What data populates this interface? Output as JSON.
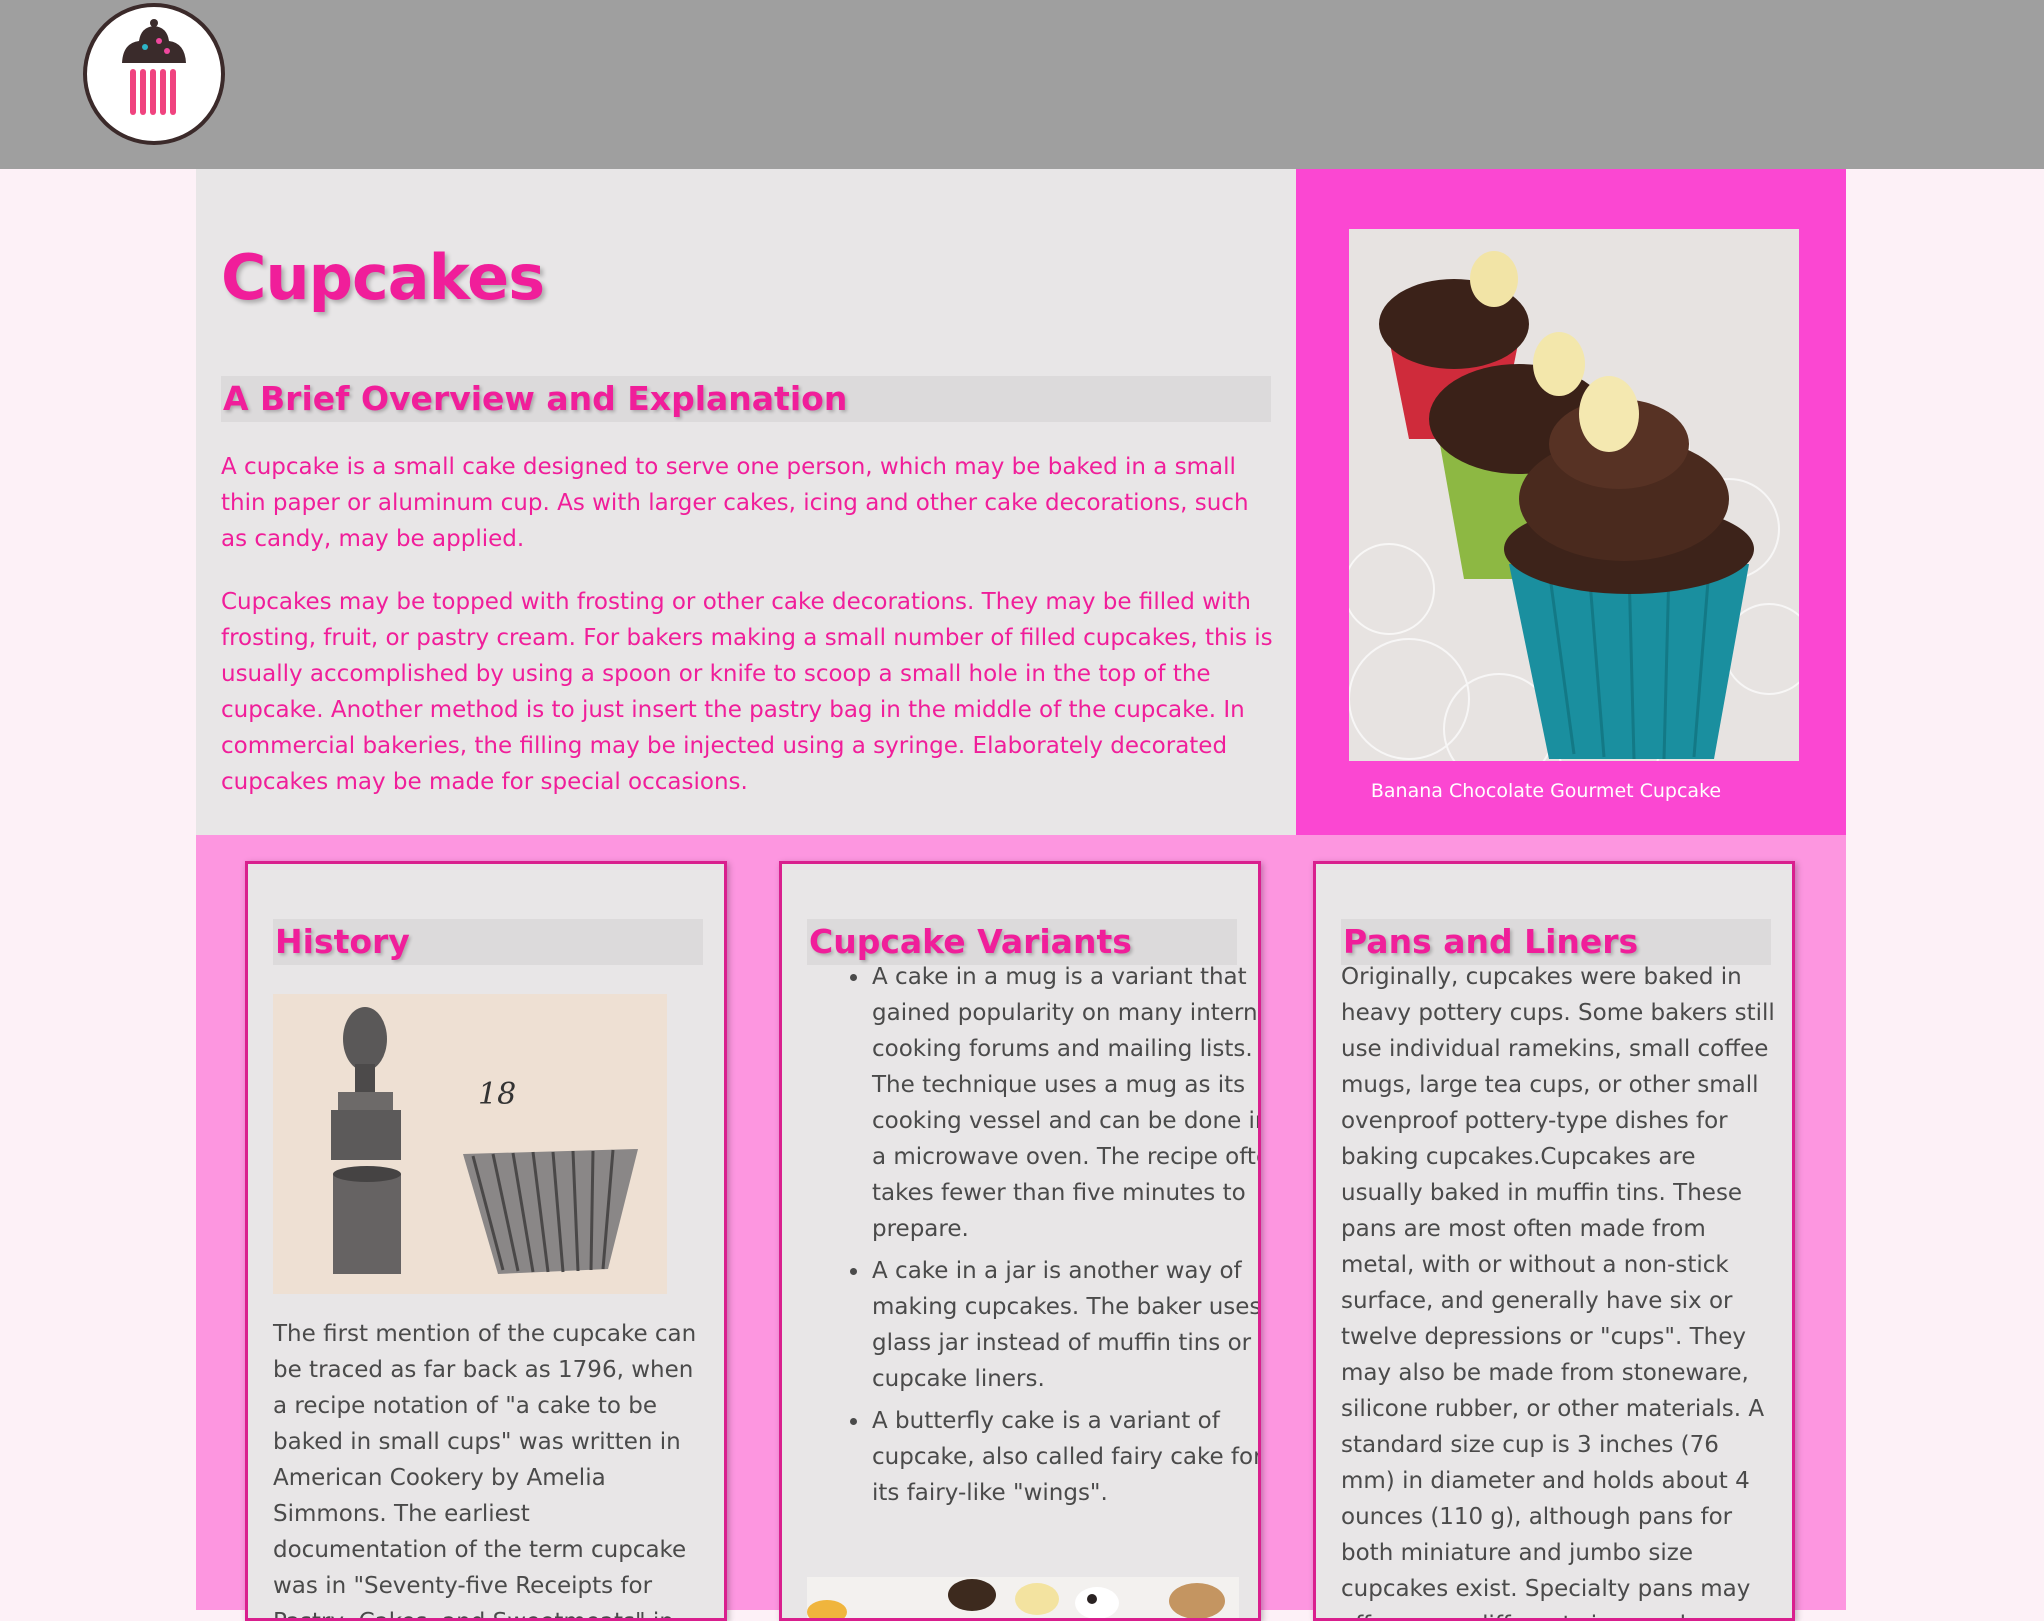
{
  "header": {
    "logo_icon": "cupcake-logo-icon"
  },
  "intro": {
    "title": "Cupcakes",
    "subtitle": "A Brief Overview and Explanation",
    "paragraphs": [
      "A cupcake is a small cake designed to serve one person, which may be baked in a small thin paper or aluminum cup. As with larger cakes, icing and other cake decorations, such as candy, may be applied.",
      "Cupcakes may be topped with frosting or other cake decorations. They may be filled with frosting, fruit, or pastry cream. For bakers making a small number of filled cupcakes, this is usually accomplished by using a spoon or knife to scoop a small hole in the top of the cupcake. Another method is to just insert the pastry bag in the middle of the cupcake. In commercial bakeries, the filling may be injected using a syringe. Elaborately decorated cupcakes may be made for special occasions."
    ]
  },
  "feature": {
    "caption": "Banana Chocolate Gourmet Cupcake"
  },
  "cards": {
    "history": {
      "title": "History",
      "text": "The first mention of the cupcake can be traced as far back as 1796, when a recipe notation of \"a cake to be baked in small cups\" was written in American Cookery by Amelia Simmons. The earliest documentation of the term cupcake was in \"Seventy-five Receipts for Pastry, Cakes, and Sweetmeats\" in"
    },
    "variants": {
      "title": "Cupcake Variants",
      "items": [
        "A cake in a mug is a variant that gained popularity on many internet cooking forums and mailing lists. The technique uses a mug as its cooking vessel and can be done in a microwave oven. The recipe often takes fewer than five minutes to prepare.",
        "A cake in a jar is another way of making cupcakes. The baker uses a glass jar instead of muffin tins or cupcake liners.",
        "A butterfly cake is a variant of cupcake, also called fairy cake for its fairy-like \"wings\"."
      ]
    },
    "pans": {
      "title": "Pans and Liners",
      "text": "Originally, cupcakes were baked in heavy pottery cups. Some bakers still use individual ramekins, small coffee mugs, large tea cups, or other small ovenproof pottery-type dishes for baking cupcakes.Cupcakes are usually baked in muffin tins. These pans are most often made from metal, with or without a non-stick surface, and generally have six or twelve depressions or \"cups\". They may also be made from stoneware, silicone rubber, or other materials. A standard size cup is 3 inches (76 mm) in diameter and holds about 4 ounces (110 g), although pans for both miniature and jumbo size cupcakes exist. Specialty pans may offer many different sizes and"
    }
  },
  "colors": {
    "accent": "#f01e9a",
    "feature_bg": "#fb47d2",
    "section_bg": "#fd96e0",
    "header_bg": "#9f9f9f",
    "panel_bg": "#e8e6e7"
  }
}
